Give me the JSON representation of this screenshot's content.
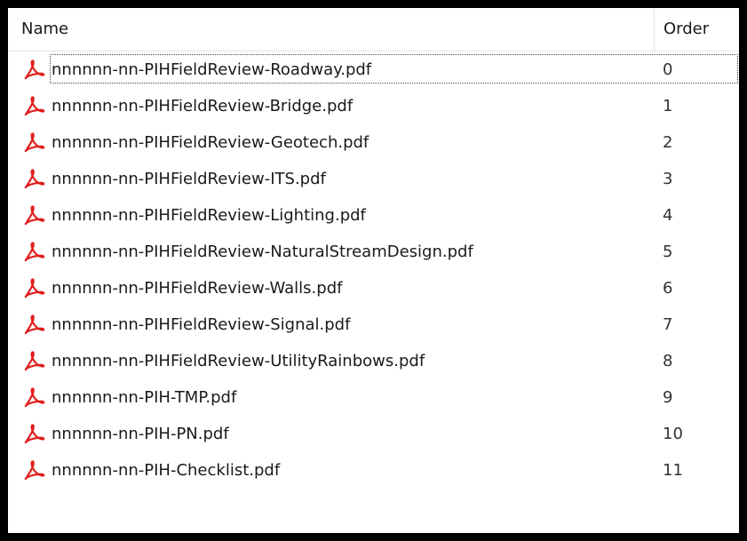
{
  "columns": {
    "name": "Name",
    "order": "Order"
  },
  "icon": "pdf-icon",
  "accent_color": "#e01e1e",
  "files": [
    {
      "name": "nnnnnn-nn-PIHFieldReview-Roadway.pdf",
      "order": "0",
      "focused": true
    },
    {
      "name": "nnnnnn-nn-PIHFieldReview-Bridge.pdf",
      "order": "1"
    },
    {
      "name": "nnnnnn-nn-PIHFieldReview-Geotech.pdf",
      "order": "2"
    },
    {
      "name": "nnnnnn-nn-PIHFieldReview-ITS.pdf",
      "order": "3"
    },
    {
      "name": "nnnnnn-nn-PIHFieldReview-Lighting.pdf",
      "order": "4"
    },
    {
      "name": "nnnnnn-nn-PIHFieldReview-NaturalStreamDesign.pdf",
      "order": "5"
    },
    {
      "name": "nnnnnn-nn-PIHFieldReview-Walls.pdf",
      "order": "6"
    },
    {
      "name": "nnnnnn-nn-PIHFieldReview-Signal.pdf",
      "order": "7"
    },
    {
      "name": "nnnnnn-nn-PIHFieldReview-UtilityRainbows.pdf",
      "order": "8"
    },
    {
      "name": "nnnnnn-nn-PIH-TMP.pdf",
      "order": "9"
    },
    {
      "name": "nnnnnn-nn-PIH-PN.pdf",
      "order": "10"
    },
    {
      "name": "nnnnnn-nn-PIH-Checklist.pdf",
      "order": "11"
    }
  ]
}
